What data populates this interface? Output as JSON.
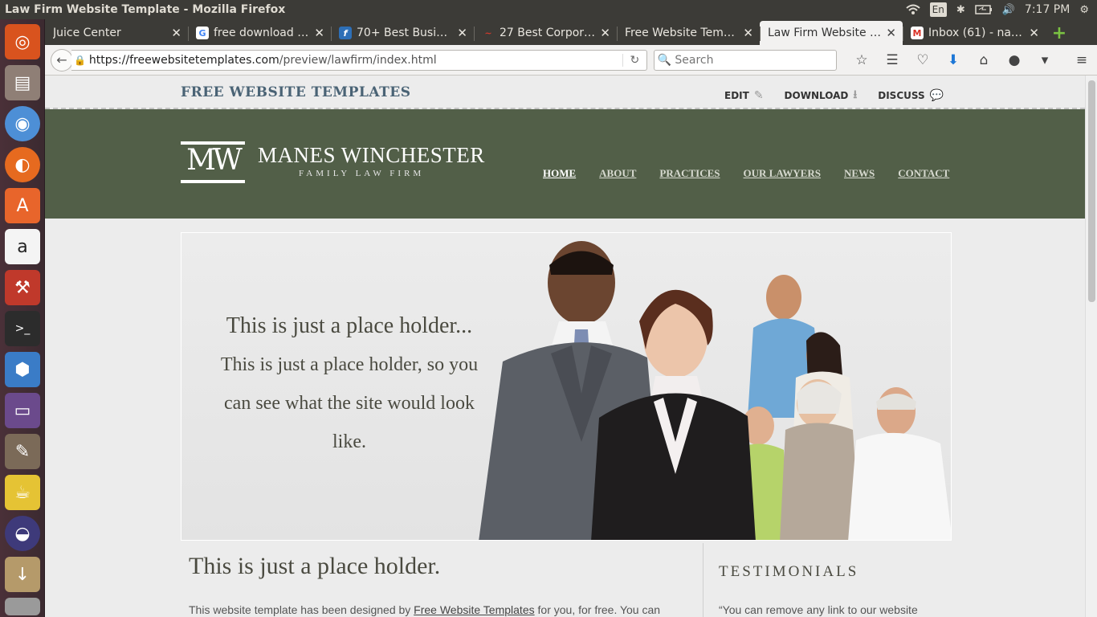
{
  "system": {
    "window_title": "Law Firm Website Template - Mozilla Firefox",
    "lang": "En",
    "time": "7:17 PM"
  },
  "launcher": {
    "items": [
      "ubuntu-dash",
      "files",
      "chromium",
      "firefox",
      "software-center",
      "amazon",
      "system-settings",
      "terminal",
      "virtualbox",
      "remote-desktop",
      "gimp",
      "teapot-app",
      "eclipse",
      "archive-manager",
      "trash"
    ]
  },
  "tabs": [
    {
      "label": "Juice Center",
      "favicon": ""
    },
    {
      "label": "free download …",
      "favicon": "G"
    },
    {
      "label": "70+ Best Busine…",
      "favicon": "f"
    },
    {
      "label": "27 Best Corpor…",
      "favicon": "~"
    },
    {
      "label": "Free Website Tem…",
      "favicon": ""
    },
    {
      "label": "Law Firm Website …",
      "favicon": ""
    },
    {
      "label": "Inbox (61) - nag…",
      "favicon": "M"
    }
  ],
  "navbar": {
    "url_host": "https://freewebsitetemplates.com",
    "url_path": "/preview/lawfirm/index.html",
    "search_placeholder": "Search"
  },
  "site": {
    "topbar_title": "FREE WEBSITE TEMPLATES",
    "edit": "EDIT",
    "download": "DOWNLOAD",
    "discuss": "DISCUSS",
    "logo_mark": "MW",
    "logo_name": "MANES WINCHESTER",
    "logo_sub": "FAMILY LAW FIRM",
    "nav": [
      "HOME",
      "ABOUT",
      "PRACTICES",
      "OUR LAWYERS",
      "NEWS",
      "CONTACT"
    ],
    "hero_heading": "This is just a place holder...",
    "hero_body": "This is just a place holder, so you can see what the site would look like.",
    "content_heading": "This is just a place holder.",
    "content_text_pre": "This website template has been designed by ",
    "content_link": "Free Website Templates",
    "content_text_post": " for you, for free. You can",
    "testimonials_heading": "TESTIMONIALS",
    "testimonial_text": "“You can remove any link to our website"
  }
}
